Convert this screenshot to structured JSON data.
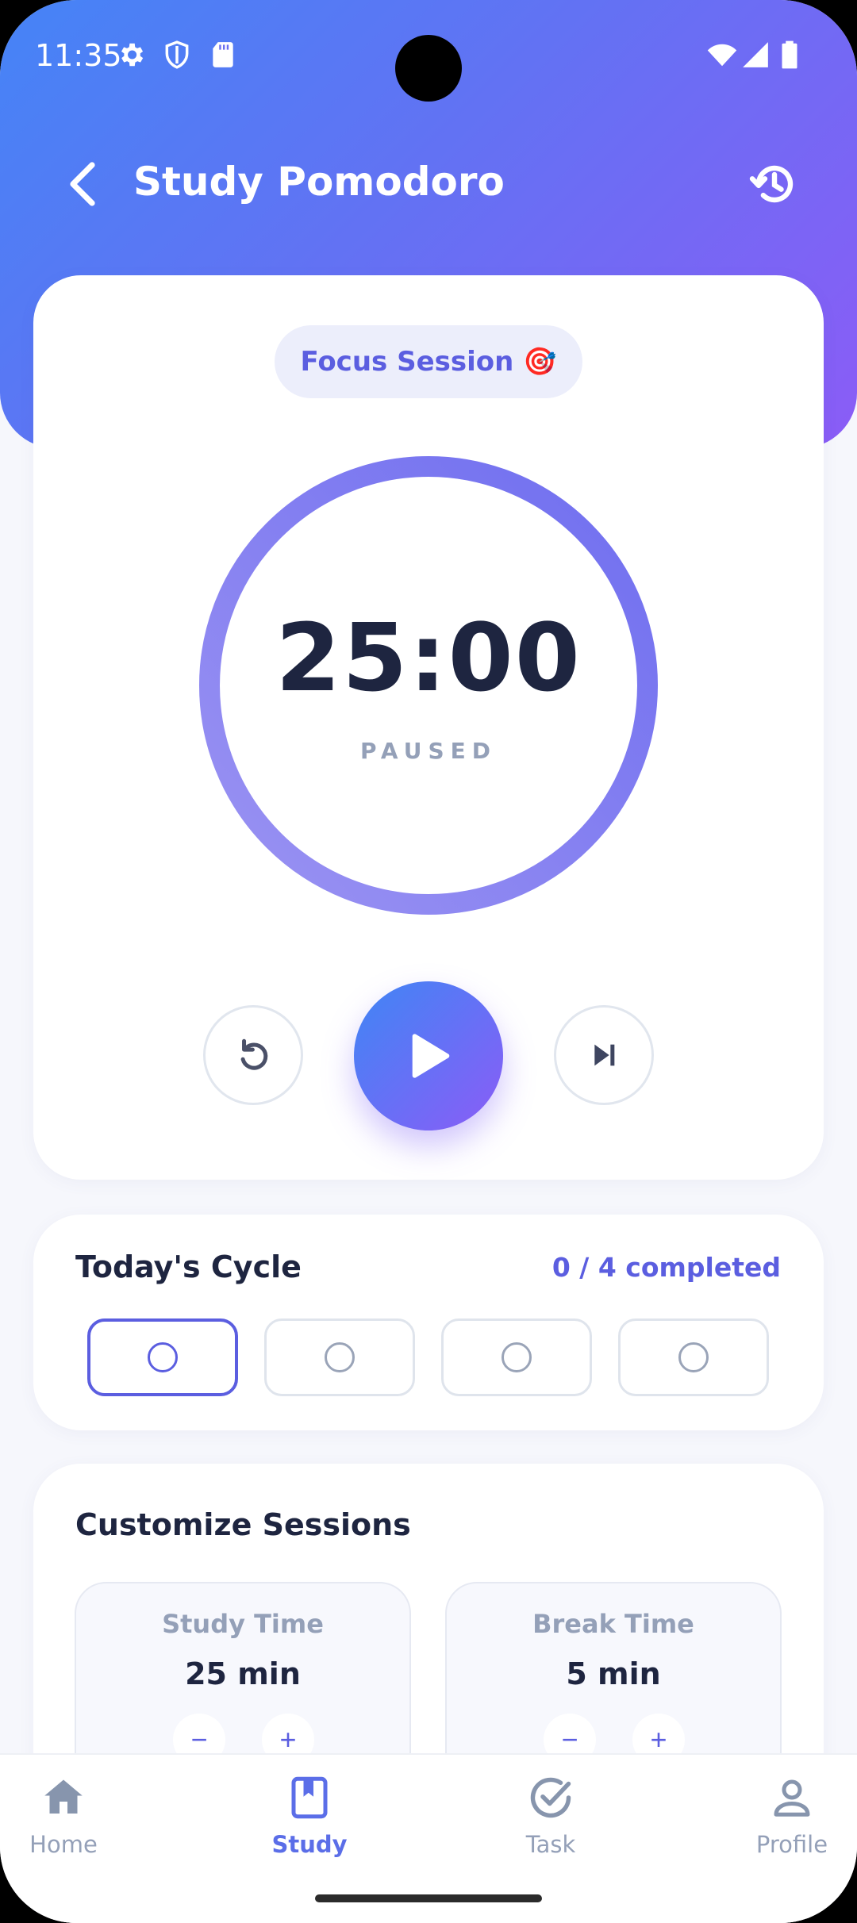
{
  "status_bar": {
    "time": "11:35"
  },
  "header": {
    "title": "Study Pomodoro"
  },
  "timer": {
    "session_chip": "Focus Session 🎯",
    "time": "25:00",
    "state": "PAUSED",
    "progress": 1.0
  },
  "cycle": {
    "title": "Today's Cycle",
    "completed": "0 / 4 completed",
    "total": 4,
    "done": 0
  },
  "customize": {
    "title": "Customize Sessions",
    "study": {
      "label": "Study Time",
      "value": "25 min",
      "dec": "−",
      "inc": "+"
    },
    "break": {
      "label": "Break Time",
      "value": "5 min",
      "dec": "−",
      "inc": "+"
    }
  },
  "nav": {
    "items": [
      {
        "label": "Home",
        "icon": "home-icon"
      },
      {
        "label": "Study",
        "icon": "book-icon",
        "active": true
      },
      {
        "label": "Task",
        "icon": "check-circle-icon"
      },
      {
        "label": "Profile",
        "icon": "person-icon"
      }
    ]
  },
  "colors": {
    "accent": "#5b5ee0",
    "gradient_start": "#4584f6",
    "gradient_end": "#8b5cf6"
  }
}
